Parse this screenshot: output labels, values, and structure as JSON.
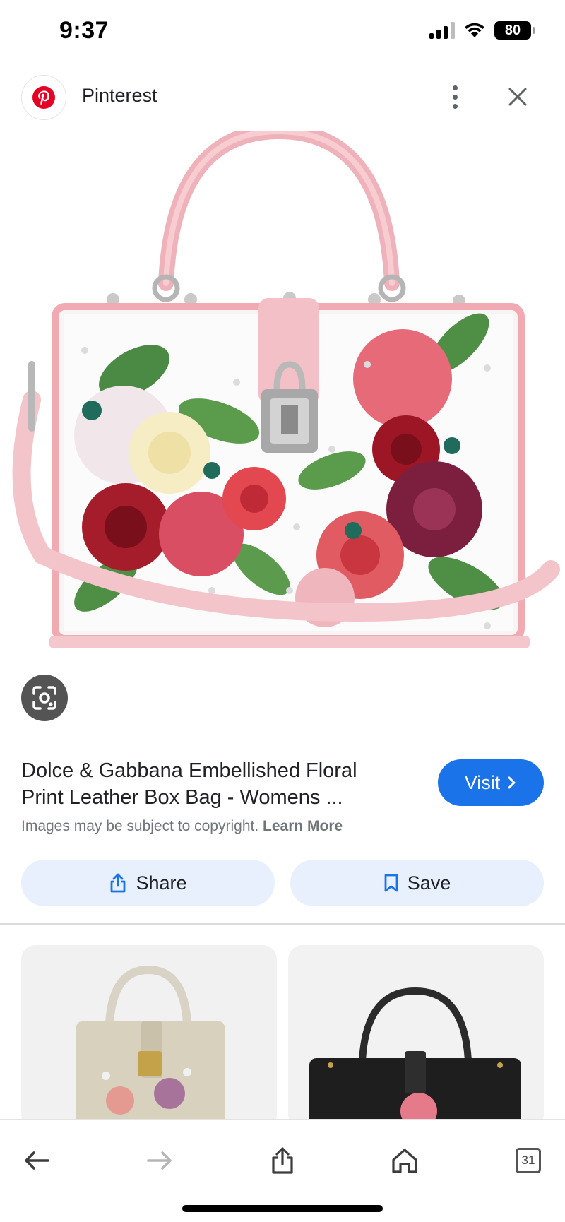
{
  "status_bar": {
    "time": "9:37",
    "battery": "80",
    "icons": [
      "signal-icon",
      "wifi-icon",
      "battery-icon"
    ]
  },
  "source": {
    "name": "Pinterest",
    "logo_icon": "pinterest-logo-icon",
    "brand_color": "#e60023"
  },
  "main_image": {
    "description_icon": "floral-box-bag-image",
    "lens_icon": "google-lens-icon"
  },
  "result": {
    "title_line1": "Dolce & Gabbana Embellished Floral",
    "title_line2": "Print Leather Box Bag - Womens ...",
    "visit_label": "Visit",
    "copyright_text": "Images may be subject to copyright.",
    "learn_more": "Learn More",
    "accent_color": "#1a73e8"
  },
  "actions": {
    "share_label": "Share",
    "save_label": "Save"
  },
  "toolbar": {
    "tab_count": "31",
    "icons": [
      "back-arrow-icon",
      "forward-arrow-icon",
      "share-icon",
      "home-icon",
      "tabs-icon"
    ]
  }
}
